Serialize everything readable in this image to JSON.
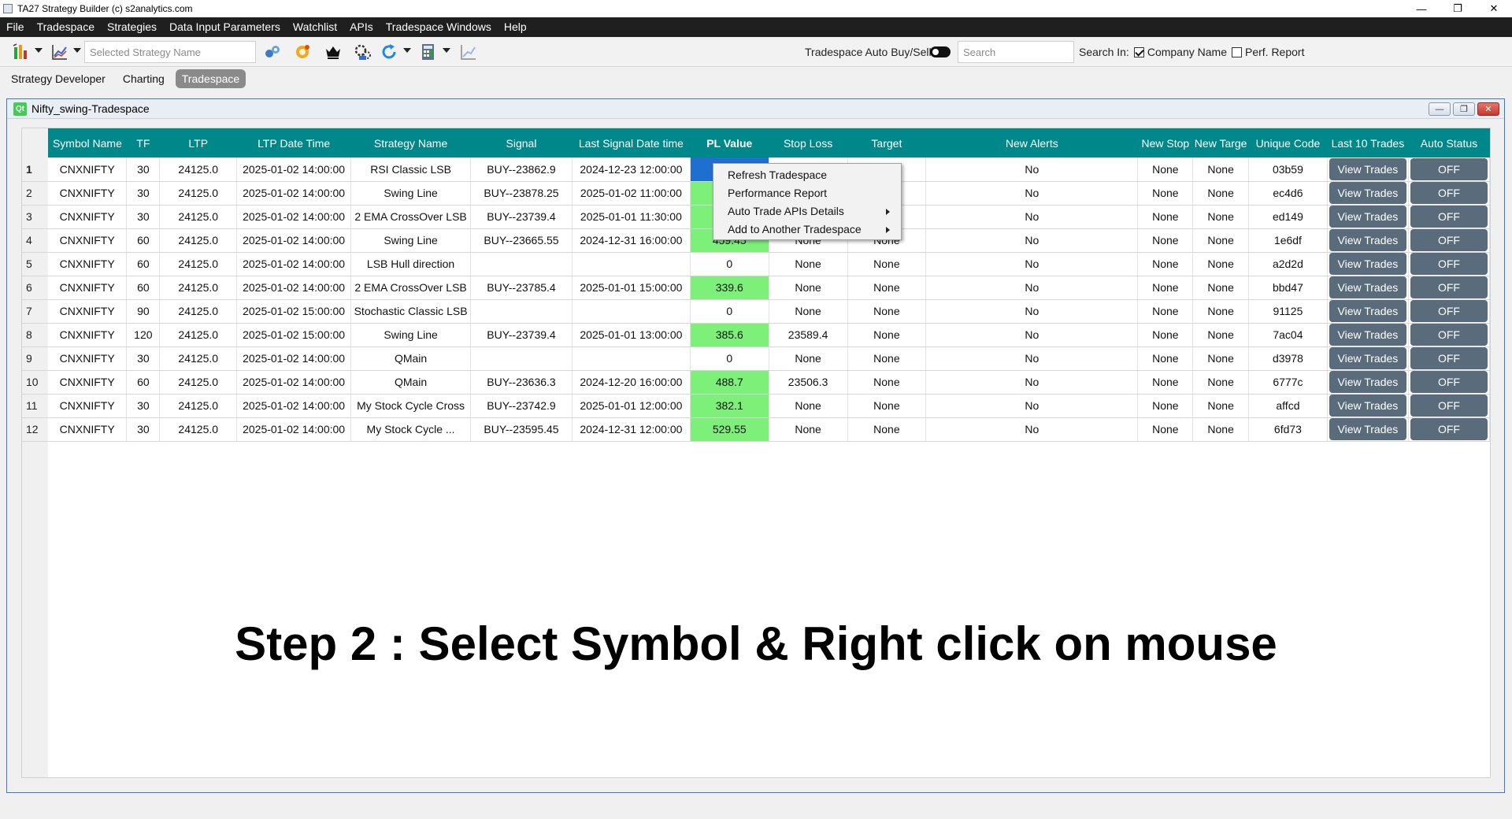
{
  "window": {
    "title": "TA27 Strategy Builder (c) s2analytics.com",
    "minimize": "—",
    "maximize": "❐",
    "close": "✕"
  },
  "menubar": [
    "File",
    "Tradespace",
    "Strategies",
    "Data Input Parameters",
    "Watchlist",
    "APIs",
    "Tradespace Windows",
    "Help"
  ],
  "toolbar": {
    "strategy_placeholder": "Selected Strategy Name",
    "auto_buy_sell_label": "Tradespace Auto Buy/Sell:",
    "search_placeholder": "Search",
    "search_in_label": "Search In:",
    "company_name_label": "Company Name",
    "company_name_checked": true,
    "perf_report_label": "Perf. Report",
    "perf_report_checked": false
  },
  "tabs": [
    "Strategy Developer",
    "Charting",
    "Tradespace"
  ],
  "active_tab": "Tradespace",
  "subwindow": {
    "title": "Nifty_swing-Tradespace",
    "icon_text": "Qt"
  },
  "table": {
    "headers": [
      "Symbol Name",
      "TF",
      "LTP",
      "LTP Date Time",
      "Strategy Name",
      "Signal",
      "Last Signal Date time",
      "PL Value",
      "Stop Loss",
      "Target",
      "New Alerts",
      "New Stop",
      "New Targe",
      "Unique Code",
      "Last 10 Trades",
      "Auto Status"
    ],
    "rows": [
      {
        "n": "1",
        "cells": [
          "CNXNIFTY",
          "30",
          "24125.0",
          "2025-01-02 14:00:00",
          "RSI Classic LSB",
          "BUY--23862.9",
          "2024-12-23 12:00:00",
          "",
          "",
          "e",
          "No",
          "None",
          "None",
          "03b59",
          "View Trades",
          "OFF"
        ]
      },
      {
        "n": "2",
        "cells": [
          "CNXNIFTY",
          "30",
          "24125.0",
          "2025-01-02 14:00:00",
          "Swing Line",
          "BUY--23878.25",
          "2025-01-02 11:00:00",
          "",
          "",
          "e",
          "No",
          "None",
          "None",
          "ec4d6",
          "View Trades",
          "OFF"
        ]
      },
      {
        "n": "3",
        "cells": [
          "CNXNIFTY",
          "30",
          "24125.0",
          "2025-01-02 14:00:00",
          "2 EMA CrossOver LSB",
          "BUY--23739.4",
          "2025-01-01 11:30:00",
          "",
          "",
          "e",
          "No",
          "None",
          "None",
          "ed149",
          "View Trades",
          "OFF"
        ]
      },
      {
        "n": "4",
        "cells": [
          "CNXNIFTY",
          "60",
          "24125.0",
          "2025-01-02 14:00:00",
          "Swing Line",
          "BUY--23665.55",
          "2024-12-31 16:00:00",
          "459.45",
          "None",
          "None",
          "No",
          "None",
          "None",
          "1e6df",
          "View Trades",
          "OFF"
        ]
      },
      {
        "n": "5",
        "cells": [
          "CNXNIFTY",
          "60",
          "24125.0",
          "2025-01-02 14:00:00",
          "LSB Hull direction",
          "",
          "",
          "0",
          "None",
          "None",
          "No",
          "None",
          "None",
          "a2d2d",
          "View Trades",
          "OFF"
        ]
      },
      {
        "n": "6",
        "cells": [
          "CNXNIFTY",
          "60",
          "24125.0",
          "2025-01-02 14:00:00",
          "2 EMA CrossOver LSB",
          "BUY--23785.4",
          "2025-01-01 15:00:00",
          "339.6",
          "None",
          "None",
          "No",
          "None",
          "None",
          "bbd47",
          "View Trades",
          "OFF"
        ]
      },
      {
        "n": "7",
        "cells": [
          "CNXNIFTY",
          "90",
          "24125.0",
          "2025-01-02 15:00:00",
          "Stochastic Classic LSB",
          "",
          "",
          "0",
          "None",
          "None",
          "No",
          "None",
          "None",
          "91125",
          "View Trades",
          "OFF"
        ]
      },
      {
        "n": "8",
        "cells": [
          "CNXNIFTY",
          "120",
          "24125.0",
          "2025-01-02 15:00:00",
          "Swing Line",
          "BUY--23739.4",
          "2025-01-01 13:00:00",
          "385.6",
          "23589.4",
          "None",
          "No",
          "None",
          "None",
          "7ac04",
          "View Trades",
          "OFF"
        ]
      },
      {
        "n": "9",
        "cells": [
          "CNXNIFTY",
          "30",
          "24125.0",
          "2025-01-02 14:00:00",
          "QMain",
          "",
          "",
          "0",
          "None",
          "None",
          "No",
          "None",
          "None",
          "d3978",
          "View Trades",
          "OFF"
        ]
      },
      {
        "n": "10",
        "cells": [
          "CNXNIFTY",
          "60",
          "24125.0",
          "2025-01-02 14:00:00",
          "QMain",
          "BUY--23636.3",
          "2024-12-20 16:00:00",
          "488.7",
          "23506.3",
          "None",
          "No",
          "None",
          "None",
          "6777c",
          "View Trades",
          "OFF"
        ]
      },
      {
        "n": "11",
        "cells": [
          "CNXNIFTY",
          "30",
          "24125.0",
          "2025-01-02 14:00:00",
          "My Stock Cycle Cross",
          "BUY--23742.9",
          "2025-01-01 12:00:00",
          "382.1",
          "None",
          "None",
          "No",
          "None",
          "None",
          "affcd",
          "View Trades",
          "OFF"
        ]
      },
      {
        "n": "12",
        "cells": [
          "CNXNIFTY",
          "30",
          "24125.0",
          "2025-01-02 14:00:00",
          "My Stock Cycle ...",
          "BUY--23595.45",
          "2024-12-31 12:00:00",
          "529.55",
          "None",
          "None",
          "No",
          "None",
          "None",
          "6fd73",
          "View Trades",
          "OFF"
        ]
      }
    ]
  },
  "context_menu": [
    "Refresh Tradespace",
    "Performance Report",
    "Auto Trade APIs Details",
    "Add to Another Tradespace"
  ],
  "caption": "Step 2 : Select Symbol & Right click on mouse",
  "colors": {
    "header_teal": "#00878a",
    "profit_green": "#7df07a",
    "selected_blue": "#1e6fd0",
    "button_slate": "#5a6c7c",
    "menubar_bg": "#1f1f1f"
  }
}
